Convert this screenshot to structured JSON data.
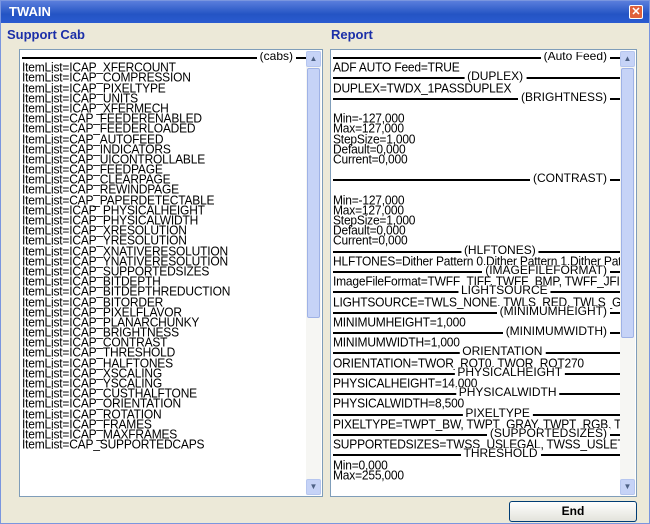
{
  "window": {
    "title": "TWAIN",
    "close_glyph": "✕"
  },
  "support_cab": {
    "label": "Support Cab",
    "header": "(cabs)",
    "items": [
      "ItemList=ICAP_XFERCOUNT",
      "ItemList=ICAP_COMPRESSION",
      "ItemList=ICAP_PIXELTYPE",
      "ItemList=ICAP_UNITS",
      "ItemList=ICAP_XFERMECH",
      "ItemList=CAP_FEEDERENABLED",
      "ItemList=CAP_FEEDERLOADED",
      "ItemList=CAP_AUTOFEED",
      "ItemList=CAP_INDICATORS",
      "ItemList=CAP_UICONTROLLABLE",
      "ItemList=CAP_FEEDPAGE",
      "ItemList=CAP_CLEARPAGE",
      "ItemList=CAP_REWINDPAGE",
      "ItemList=CAP_PAPERDETECTABLE",
      "ItemList=ICAP_PHYSICALHEIGHT",
      "ItemList=ICAP_PHYSICALWIDTH",
      "ItemList=ICAP_XRESOLUTION",
      "ItemList=ICAP_YRESOLUTION",
      "ItemList=ICAP_XNATIVERESOLUTION",
      "ItemList=ICAP_YNATIVERESOLUTION",
      "ItemList=ICAP_SUPPORTEDSIZES",
      "ItemList=ICAP_BITDEPTH",
      "ItemList=ICAP_BITDEPTHREDUCTION",
      "ItemList=ICAP_BITORDER",
      "ItemList=ICAP_PIXELFLAVOR",
      "ItemList=ICAP_PLANARCHUNKY",
      "ItemList=ICAP_BRIGHTNESS",
      "ItemList=ICAP_CONTRAST",
      "ItemList=ICAP_THRESHOLD",
      "ItemList=ICAP_HALFTONES",
      "ItemList=ICAP_XSCALING",
      "ItemList=ICAP_YSCALING",
      "ItemList=ICAP_CUSTHALFTONE",
      "ItemList=ICAP_ORIENTATION",
      "ItemList=ICAP_ROTATION",
      "ItemList=ICAP_FRAMES",
      "ItemList=ICAP_MAXFRAMES",
      "ItemList=CAP_SUPPORTEDCAPS"
    ]
  },
  "report": {
    "label": "Report",
    "lines": [
      {
        "type": "sep",
        "text": "(Auto Feed)",
        "align": "r"
      },
      {
        "type": "text",
        "text": "ADF AUTO Feed=TRUE"
      },
      {
        "type": "sep",
        "text": "(DUPLEX)",
        "align": "c"
      },
      {
        "type": "text",
        "text": "DUPLEX=TWDX_1PASSDUPLEX"
      },
      {
        "type": "sep",
        "text": "(BRIGHTNESS)",
        "align": "r"
      },
      {
        "type": "text",
        "text": ""
      },
      {
        "type": "text",
        "text": "Min=-127,000"
      },
      {
        "type": "text",
        "text": "Max=127,000"
      },
      {
        "type": "text",
        "text": "StepSize=1,000"
      },
      {
        "type": "text",
        "text": "Default=0,000"
      },
      {
        "type": "text",
        "text": "Current=0,000"
      },
      {
        "type": "text",
        "text": ""
      },
      {
        "type": "sep",
        "text": "(CONTRAST)",
        "align": "r"
      },
      {
        "type": "text",
        "text": ""
      },
      {
        "type": "text",
        "text": "Min=-127,000"
      },
      {
        "type": "text",
        "text": "Max=127,000"
      },
      {
        "type": "text",
        "text": "StepSize=1,000"
      },
      {
        "type": "text",
        "text": "Default=0,000"
      },
      {
        "type": "text",
        "text": "Current=0,000"
      },
      {
        "type": "sep",
        "text": "(HLFTONES)",
        "align": "c"
      },
      {
        "type": "text",
        "text": "HLFTONES=Dither Pattern 0,Dither Pattern 1,Dither Patt"
      },
      {
        "type": "sep",
        "text": "(IMAGEFILEFORMAT)",
        "align": "r"
      },
      {
        "type": "text",
        "text": "ImageFileFormat=TWFF_TIFF, TWFF_BMP, TWFF_JFIF"
      },
      {
        "type": "sep",
        "text": "LIGHTSOURCE",
        "align": "c"
      },
      {
        "type": "text",
        "text": "LIGHTSOURCE=TWLS_NONE, TWLS_RED, TWLS_GREE"
      },
      {
        "type": "sep",
        "text": "(MINIMUMHEIGHT)",
        "align": "r"
      },
      {
        "type": "text",
        "text": "MINIMUMHEIGHT=1,000"
      },
      {
        "type": "sep",
        "text": "(MINIMUMWIDTH)",
        "align": "r"
      },
      {
        "type": "text",
        "text": "MINIMUMWIDTH=1,000"
      },
      {
        "type": "sep",
        "text": "ORIENTATION",
        "align": "c"
      },
      {
        "type": "text",
        "text": "ORIENTATION=TWOR_ROT0, TWOR_ROT270"
      },
      {
        "type": "sep",
        "text": "PHYSICALHEIGHT",
        "align": "c"
      },
      {
        "type": "text",
        "text": "PHYSICALHEIGHT=14,000"
      },
      {
        "type": "sep",
        "text": "PHYSICALWIDTH",
        "align": "c"
      },
      {
        "type": "text",
        "text": "PHYSICALWIDTH=8,500"
      },
      {
        "type": "sep",
        "text": "PIXELTYPE",
        "align": "c"
      },
      {
        "type": "text",
        "text": "PIXELTYPE=TWPT_BW, TWPT_GRAY, TWPT_RGB, TWP"
      },
      {
        "type": "sep",
        "text": "(SUPPORTEDSIZES)",
        "align": "r"
      },
      {
        "type": "text",
        "text": "SUPPORTEDSIZES=TWSS_USLEGAL, TWSS_USLETTE"
      },
      {
        "type": "sep",
        "text": "THRESHOLD",
        "align": "c"
      },
      {
        "type": "text",
        "text": "Min=0,000"
      },
      {
        "type": "text",
        "text": "Max=255,000"
      }
    ]
  },
  "buttons": {
    "end": "End"
  },
  "scroll": {
    "left_position": 0.0,
    "right_position": 0.0
  },
  "colors": {
    "title_bar": "#2454c4",
    "label_text": "#1b2fa8",
    "panel_border": "#7f9db9"
  }
}
